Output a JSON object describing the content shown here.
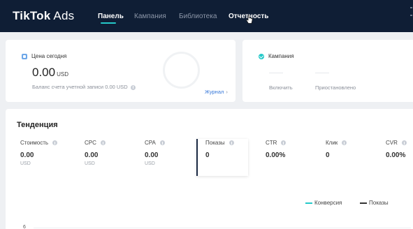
{
  "header": {
    "logo_main": "TikTok",
    "logo_sub": "Ads",
    "nav": [
      {
        "label": "Панель",
        "active": true
      },
      {
        "label": "Кампания",
        "active": false
      },
      {
        "label": "Библиотека",
        "active": false
      },
      {
        "label": "Отчетность",
        "active": false
      }
    ]
  },
  "today_card": {
    "label": "Цена сегодня",
    "amount": "0.00",
    "currency": "USD",
    "balance_text": "Баланс счета учетной записи 0.00 USD",
    "journal_link": "Журнал"
  },
  "campaign_card": {
    "label": "Кампания",
    "statuses": [
      "Включить",
      "Приостановлено"
    ]
  },
  "trend": {
    "title": "Тенденция",
    "metrics": [
      {
        "name": "Стоимость",
        "value": "0.00",
        "unit": "USD"
      },
      {
        "name": "CPC",
        "value": "0.00",
        "unit": "USD"
      },
      {
        "name": "CPA",
        "value": "0.00",
        "unit": "USD"
      },
      {
        "name": "Показы",
        "value": "0",
        "unit": ""
      },
      {
        "name": "CTR",
        "value": "0.00%",
        "unit": ""
      },
      {
        "name": "Клик",
        "value": "0",
        "unit": ""
      },
      {
        "name": "CVR",
        "value": "0.00%",
        "unit": ""
      }
    ],
    "selected_metric": "Показы",
    "legend": [
      {
        "name": "Конверсия",
        "color": "#25c9c9"
      },
      {
        "name": "Показы",
        "color": "#333333"
      }
    ],
    "y_tick": "6"
  },
  "colors": {
    "header_bg": "#0f1e35",
    "accent": "#25c9c9",
    "link": "#3577d9"
  }
}
